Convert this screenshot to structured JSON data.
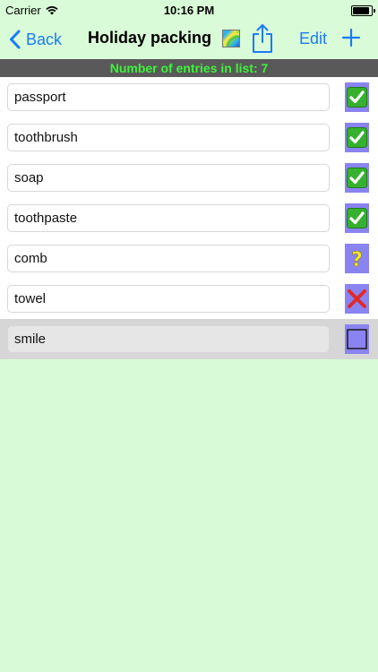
{
  "status_bar": {
    "carrier": "Carrier",
    "time": "10:16 PM",
    "battery_level": 1.0
  },
  "nav": {
    "back_label": "Back",
    "title": "Holiday packing",
    "edit_label": "Edit"
  },
  "banner": {
    "count_text": "Number of entries in list: 7"
  },
  "items": [
    {
      "label": "passport",
      "status": "checked"
    },
    {
      "label": "toothbrush",
      "status": "checked"
    },
    {
      "label": "soap",
      "status": "checked"
    },
    {
      "label": "toothpaste",
      "status": "checked"
    },
    {
      "label": "comb",
      "status": "question"
    },
    {
      "label": "towel",
      "status": "cross"
    },
    {
      "label": "smile",
      "status": "empty"
    }
  ],
  "selected_index": 6,
  "colors": {
    "background": "#d8fad6",
    "accent": "#1a7cf5",
    "banner_bg": "#595959",
    "banner_text": "#3ef23a",
    "status_button": "#8a83f2",
    "check_green": "#36b02f",
    "question_yellow": "#f4ea2a",
    "cross_red": "#e02a2a"
  }
}
